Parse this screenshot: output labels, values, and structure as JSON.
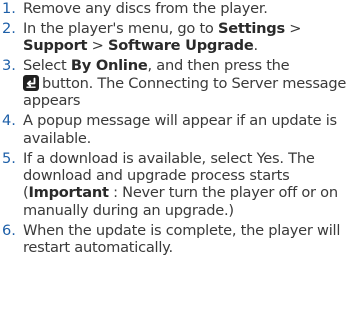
{
  "steps": [
    {
      "number": "1.",
      "text": "Remove any discs from the player."
    },
    {
      "number": "2.",
      "pre": "In the player's menu, go to ",
      "kw1": "Settings",
      "sep1": " > ",
      "kw2": "Support",
      "sep2": " > ",
      "kw3": "Software Upgrade",
      "post": "."
    },
    {
      "number": "3.",
      "pre": "Select ",
      "kw": "By Online",
      "mid": ", and then press the",
      "icon": "enter-button-icon",
      "post": "button. The Connecting to Server message appears"
    },
    {
      "number": "4.",
      "text": "A popup message will appear if an update is available."
    },
    {
      "number": "5.",
      "pre": "If a download is available, select Yes. The download and upgrade process starts (",
      "kw": "Important",
      "post": " : Never turn the player off or on manually during an upgrade.)"
    },
    {
      "number": "6.",
      "text": "When the update is complete, the player will restart automatically."
    }
  ],
  "colors": {
    "number": "#1d5fa8",
    "text": "#3a3a3a",
    "icon_bg": "#1f1f1f"
  }
}
